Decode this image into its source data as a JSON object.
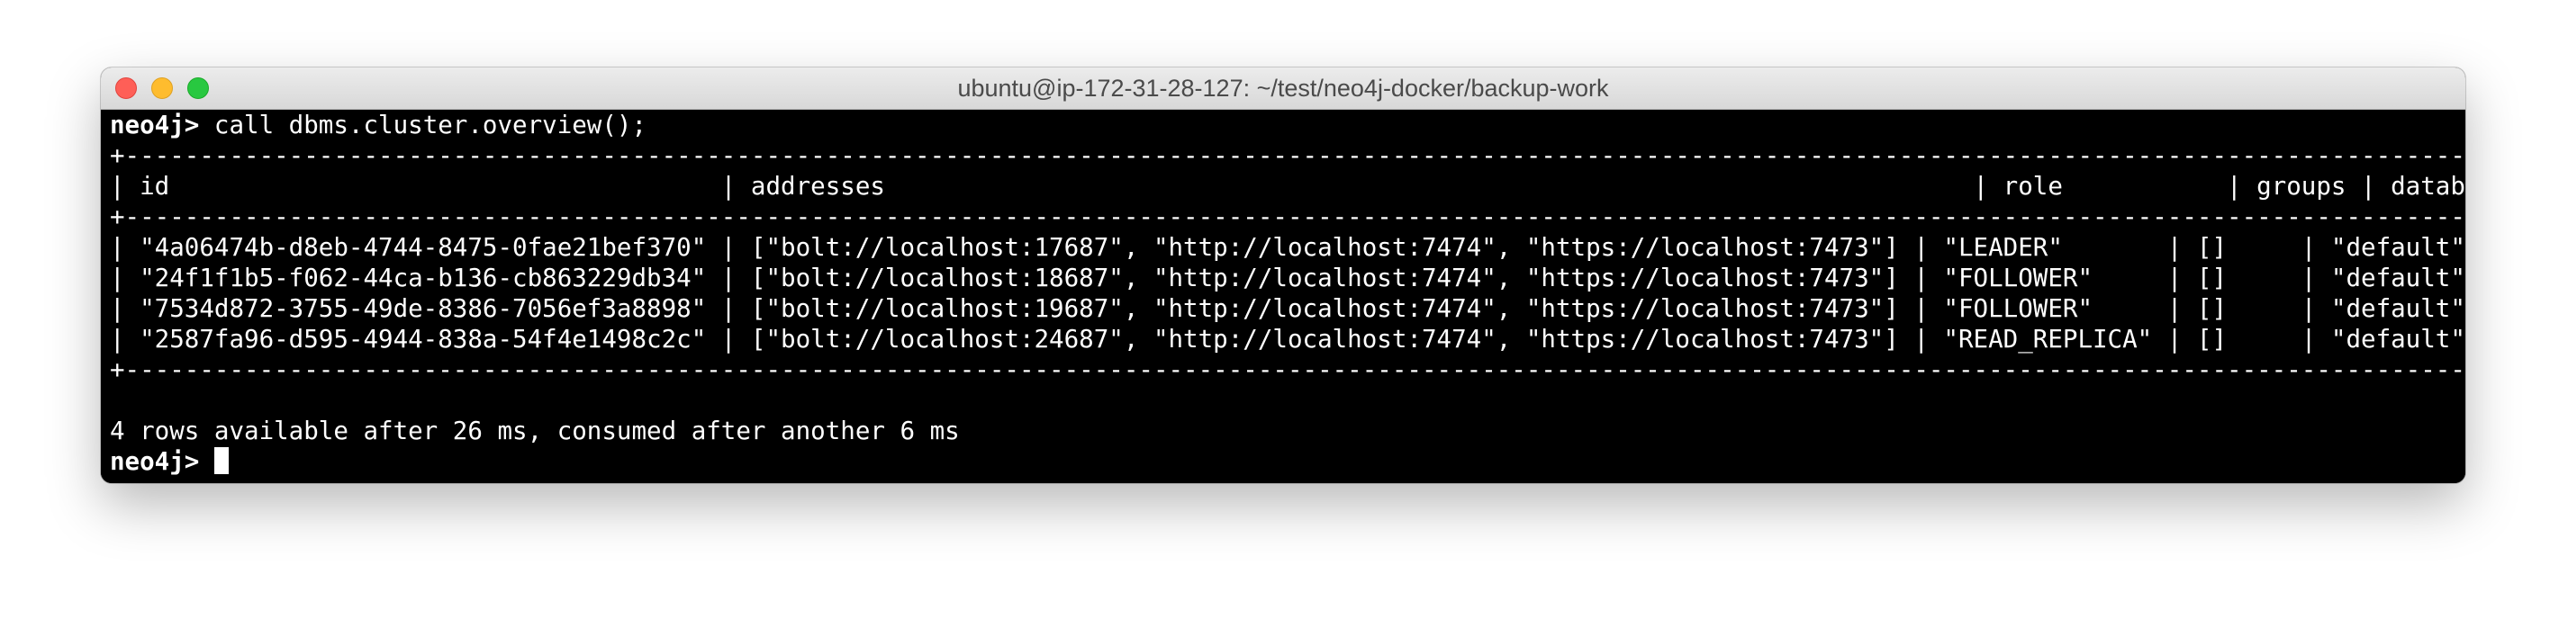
{
  "window": {
    "title": "ubuntu@ip-172-31-28-127: ~/test/neo4j-docker/backup-work",
    "controls": {
      "close_glyph": "×",
      "minimize_glyph": "",
      "maximize_glyph": ""
    }
  },
  "terminal": {
    "prompt": "neo4j>",
    "command": " call dbms.cluster.overview();",
    "table": {
      "border": "+-----------------------------------------------------------------------------------------------------------------------------------------------------------------------------------------------+",
      "header": "| id                                     | addresses                                                                         | role           | groups | database  |",
      "rows": [
        "| \"4a06474b-d8eb-4744-8475-0fae21bef370\" | [\"bolt://localhost:17687\", \"http://localhost:7474\", \"https://localhost:7473\"] | \"LEADER\"       | []     | \"default\" |",
        "| \"24f1f1b5-f062-44ca-b136-cb863229db34\" | [\"bolt://localhost:18687\", \"http://localhost:7474\", \"https://localhost:7473\"] | \"FOLLOWER\"     | []     | \"default\" |",
        "| \"7534d872-3755-49de-8386-7056ef3a8898\" | [\"bolt://localhost:19687\", \"http://localhost:7474\", \"https://localhost:7473\"] | \"FOLLOWER\"     | []     | \"default\" |",
        "| \"2587fa96-d595-4944-838a-54f4e1498c2c\" | [\"bolt://localhost:24687\", \"http://localhost:7474\", \"https://localhost:7473\"] | \"READ_REPLICA\" | []     | \"default\" |"
      ]
    },
    "summary": "4 rows available after 26 ms, consumed after another 6 ms",
    "final_prompt": "neo4j>"
  }
}
